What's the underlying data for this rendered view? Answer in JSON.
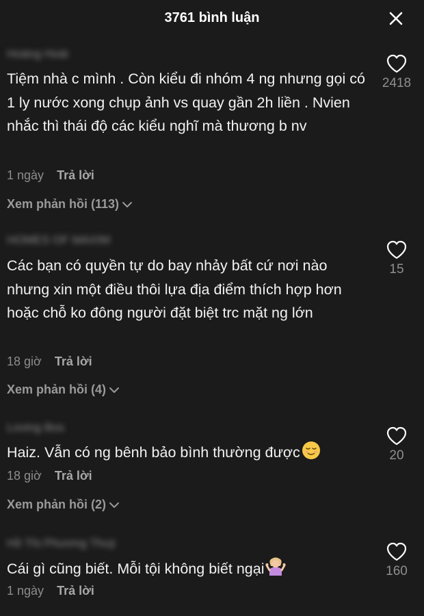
{
  "header": {
    "title": "3761 bình luận"
  },
  "comments": [
    {
      "username": "Hoàng Hoài",
      "text": "Tiệm nhà c mình . Còn kiểu đi nhóm 4 ng nhưng gọi có 1 ly nước xong chụp ảnh vs quay gần 2h liền . Nvien nhắc thì thái độ các kiểu nghĩ mà thương b nv",
      "time": "1 ngày",
      "reply_label": "Trả lời",
      "view_replies": "Xem phản hồi (113)",
      "likes": "2418"
    },
    {
      "username": "HOMES OF MAXIM",
      "text": "Các bạn có quyền tự do bay nhảy bất cứ nơi nào nhưng xin một điều thôi lựa địa điểm thích hợp hơn hoặc chỗ ko đông người đặt biệt trc mặt ng lớn",
      "time": "18 giờ",
      "reply_label": "Trả lời",
      "view_replies": "Xem phản hồi (4)",
      "likes": "15"
    },
    {
      "username": "Loving Bos",
      "text": "Haiz. Vẫn có ng bênh bảo bình thường được",
      "emoji": "relieved-face-emoji",
      "time": "18 giờ",
      "reply_label": "Trả lời",
      "view_replies": "Xem phản hồi (2)",
      "likes": "20"
    },
    {
      "username": "Hồ Thị Phương Thuý",
      "text": "Cái gì cũng biết. Mỗi tội không biết ngại",
      "emoji": "person-shrugging-emoji",
      "time": "1 ngày",
      "reply_label": "Trả lời",
      "likes": "160"
    }
  ],
  "icons": {
    "close": "close-icon",
    "like": "heart-icon",
    "expand": "chevron-down-icon"
  },
  "colors": {
    "background": "#1b1b1b",
    "text": "#f2f2f2",
    "muted": "#8d8d8d"
  }
}
